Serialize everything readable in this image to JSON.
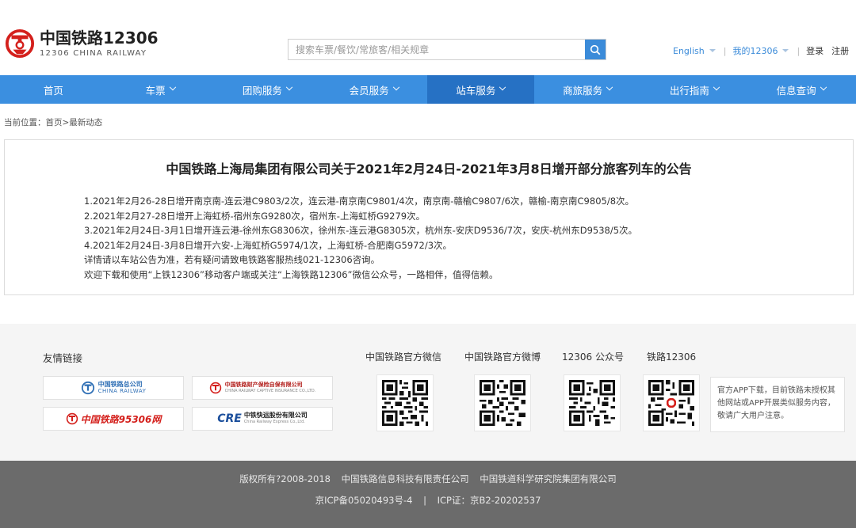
{
  "header": {
    "logo_cn": "中国铁路12306",
    "logo_en": "12306 CHINA RAILWAY",
    "search_placeholder": "搜索车票/餐饮/常旅客/相关规章",
    "lang_label": "English",
    "my12306_label": "我的12306",
    "login_label": "登录",
    "register_label": "注册"
  },
  "nav": {
    "items": [
      {
        "label": "首页",
        "dropdown": false
      },
      {
        "label": "车票",
        "dropdown": true
      },
      {
        "label": "团购服务",
        "dropdown": true
      },
      {
        "label": "会员服务",
        "dropdown": true
      },
      {
        "label": "站车服务",
        "dropdown": true,
        "active": true
      },
      {
        "label": "商旅服务",
        "dropdown": true
      },
      {
        "label": "出行指南",
        "dropdown": true
      },
      {
        "label": "信息查询",
        "dropdown": true
      }
    ]
  },
  "breadcrumb": "当前位置：首页>最新动态",
  "article": {
    "title": "中国铁路上海局集团有限公司关于2021年2月24日-2021年3月8日增开部分旅客列车的公告",
    "lines": [
      "1.2021年2月26-28日增开南京南-连云港C9803/2次，连云港-南京南C9801/4次，南京南-赣榆C9807/6次，赣榆-南京南C9805/8次。",
      "2.2021年2月27-28日增开上海虹桥-宿州东G9280次，宿州东-上海虹桥G9279次。",
      "3.2021年2月24日-3月1日增开连云港-徐州东G8306次，徐州东-连云港G8305次，杭州东-安庆D9536/7次，安庆-杭州东D9538/5次。",
      "4.2021年2月24日-3月8日增开六安-上海虹桥G5974/1次，上海虹桥-合肥南G5972/3次。",
      "详情请以车站公告为准，若有疑问请致电铁路客服热线021-12306咨询。",
      "欢迎下载和使用“上铁12306”移动客户端或关注“上海铁路12306”微信公众号，一路相伴，值得信赖。"
    ]
  },
  "footer": {
    "links_title": "友情链接",
    "partners": [
      {
        "text": "中国铁路总公司",
        "sub": "CHINA RAILWAY"
      },
      {
        "text": "中国铁路财产保险自保有限公司",
        "sub": "CHINA RAILWAY CAPTIVE INSURANCE CO.,LTD."
      },
      {
        "text": "中国铁路95306网",
        "sub": ""
      },
      {
        "text": "中铁快运股份有限公司",
        "sub": "China Railway Express Co.,Ltd."
      }
    ],
    "qr_labels": [
      "中国铁路官方微信",
      "中国铁路官方微博",
      "12306 公众号",
      "铁路12306"
    ],
    "notice": "官方APP下载，目前铁路未授权其他网站或APP开展类似服务内容，敬请广大用户注意。",
    "copyright": [
      "版权所有?2008-2018",
      "中国铁路信息科技有限责任公司",
      "中国铁道科学研究院集团有限公司"
    ],
    "icp_1": "京ICP备05020493号-4",
    "icp_2": "ICP证：京B2-20202537"
  },
  "colors": {
    "nav_bg": "#3b8fe0",
    "nav_active": "#2671c4",
    "brand_red": "#d4201c",
    "link_blue": "#3b8bd9",
    "footer_bg": "#6b6b6b"
  }
}
